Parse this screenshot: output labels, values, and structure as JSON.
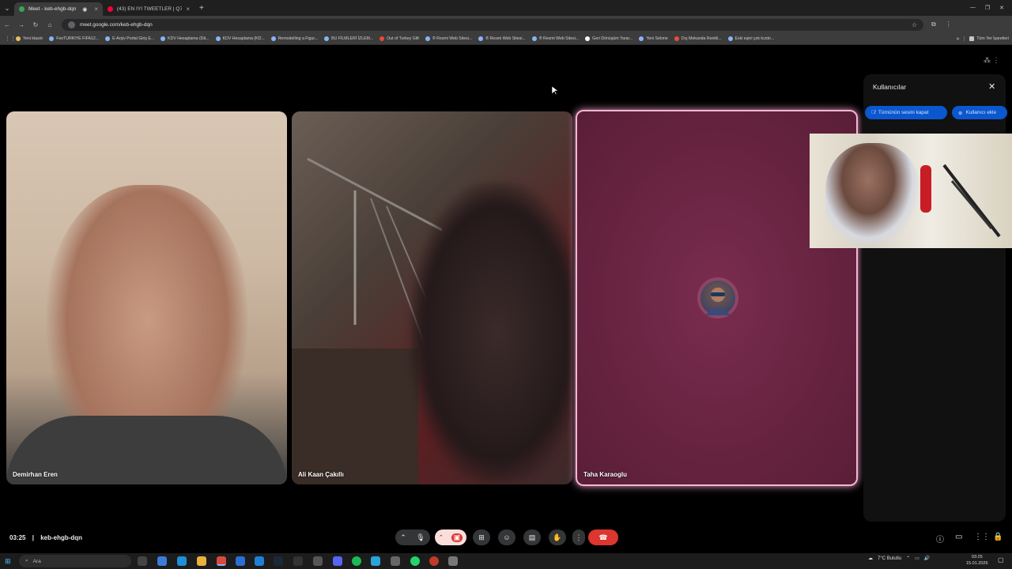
{
  "browser": {
    "tabs": [
      {
        "label": "Meet - keb-ehgb-dqn",
        "fav": "#34a853"
      },
      {
        "label": "(43) EN İYİ TWEETLER | Q7 ADA",
        "fav": "#ff0033"
      }
    ],
    "new_tab": "+",
    "url": "meet.google.com/keb-ehgb-dqn",
    "bookmarks": [
      "Yeni klasör",
      "FeeTURKIYE FIFA12...",
      "E-Arşiv Portal Giriş E...",
      "KDV Hesaplama (Dâ...",
      "KDV Hesaplama (KD...",
      "Remodelling a Figur...",
      "BU FİLMLERİ İZLEM...",
      "Out of Turkey Gift",
      "® Resmi Web Sitesi...",
      "® Resmi Web Sitesi...",
      "® Resmi Web Sitesi...",
      "Geri Dönüşüm Yarar...",
      "Yeni Sekme",
      "Dış Mekanda Renkli...",
      "Eski eşini çok kızdır..."
    ],
    "bookmarks_more": "»",
    "other_bookmarks": "Tüm Yer İşaretleri"
  },
  "meet": {
    "participants": [
      {
        "name": "Demirhan Eren"
      },
      {
        "name": "Ali Kaan Çakıllı"
      },
      {
        "name": "Taha Karaoglu"
      }
    ],
    "panel": {
      "title": "Kullanıcılar",
      "mute_all": "Tümünün sesini kapat",
      "add_people": "Kullanıcı ekle"
    },
    "time": "03:25",
    "separator": "|",
    "meeting_code": "keb-ehgb-dqn"
  },
  "taskbar": {
    "search_placeholder": "Ara",
    "weather": "7°C Bulutlu",
    "clock_time": "03:25",
    "clock_date": "15.01.2026"
  }
}
